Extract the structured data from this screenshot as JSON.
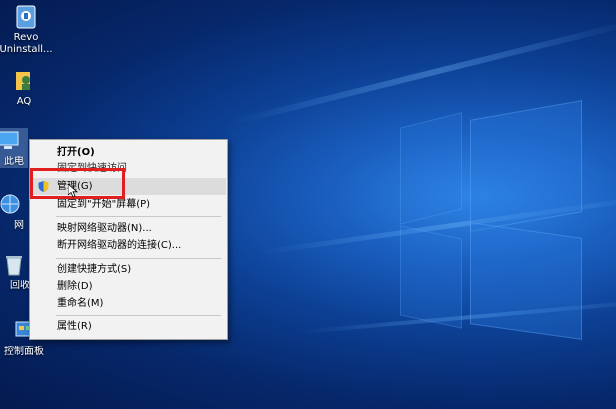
{
  "desktop": {
    "icons": [
      {
        "name": "revo",
        "label_line1": "Revo",
        "label_line2": "Uninstall..."
      },
      {
        "name": "aq",
        "label": "AQ"
      },
      {
        "name": "this-pc",
        "label": "此电"
      },
      {
        "name": "network",
        "label": "网"
      },
      {
        "name": "recycle-bin",
        "label": "回收"
      },
      {
        "name": "control-panel",
        "label": "控制面板"
      }
    ]
  },
  "context_menu": {
    "items": [
      {
        "label": "打开(O)"
      },
      {
        "label": "固定到快速访问"
      },
      {
        "label": "管理(G)"
      },
      {
        "label": "固定到\"开始\"屏幕(P)"
      },
      {
        "label": "映射网络驱动器(N)..."
      },
      {
        "label": "断开网络驱动器的连接(C)..."
      },
      {
        "label": "创建快捷方式(S)"
      },
      {
        "label": "删除(D)"
      },
      {
        "label": "重命名(M)"
      },
      {
        "label": "属性(R)"
      }
    ],
    "highlight_color": "#e02020"
  }
}
